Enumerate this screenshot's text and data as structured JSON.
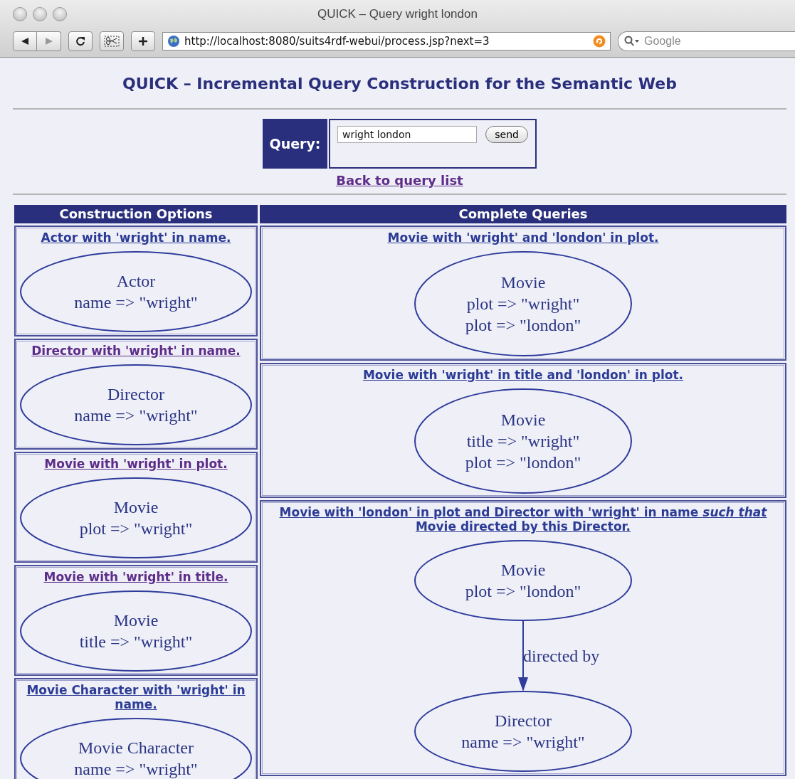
{
  "browser": {
    "title": "QUICK – Query wright london",
    "url": "http://localhost:8080/suits4rdf-webui/process.jsp?next=3",
    "search": {
      "placeholder": "Google"
    }
  },
  "page": {
    "heading": "QUICK – Incremental Query Construction for the Semantic Web",
    "query": {
      "label": "Query:",
      "value": "wright london",
      "button": "send"
    },
    "back_link": {
      "label": "Back to query list",
      "visited": true
    },
    "construction_options": {
      "title": "Construction Options",
      "items": [
        {
          "link": "Actor with 'wright' in name.",
          "visited": false,
          "nodes": [
            {
              "lines": [
                "Actor",
                "name => \"wright\""
              ]
            }
          ]
        },
        {
          "link": "Director with 'wright' in name.",
          "visited": true,
          "nodes": [
            {
              "lines": [
                "Director",
                "name => \"wright\""
              ]
            }
          ]
        },
        {
          "link": "Movie with 'wright' in plot.",
          "visited": true,
          "nodes": [
            {
              "lines": [
                "Movie",
                "plot => \"wright\""
              ]
            }
          ]
        },
        {
          "link": "Movie with 'wright' in title.",
          "visited": true,
          "nodes": [
            {
              "lines": [
                "Movie",
                "title => \"wright\""
              ]
            }
          ]
        },
        {
          "link": "Movie Character with 'wright' in name.",
          "visited": false,
          "nodes": [
            {
              "lines": [
                "Movie Character",
                "name => \"wright\""
              ]
            }
          ]
        }
      ]
    },
    "complete_queries": {
      "title": "Complete Queries",
      "items": [
        {
          "link": "Movie with 'wright' and 'london' in plot.",
          "visited": false,
          "nodes": [
            {
              "lines": [
                "Movie",
                "plot => \"wright\"",
                "plot => \"london\""
              ]
            }
          ]
        },
        {
          "link": "Movie with 'wright' in title and 'london' in plot.",
          "visited": false,
          "nodes": [
            {
              "lines": [
                "Movie",
                "title => \"wright\"",
                "plot => \"london\""
              ]
            }
          ]
        },
        {
          "link": "Movie with 'london' in plot and Director with 'wright' in name *such that* Movie directed by this Director.",
          "visited": false,
          "nodes": [
            {
              "lines": [
                "Movie",
                "plot => \"london\""
              ],
              "edge_to_next": {
                "label": "directed by"
              }
            },
            {
              "lines": [
                "Director",
                "name => \"wright\""
              ]
            }
          ]
        }
      ]
    }
  }
}
